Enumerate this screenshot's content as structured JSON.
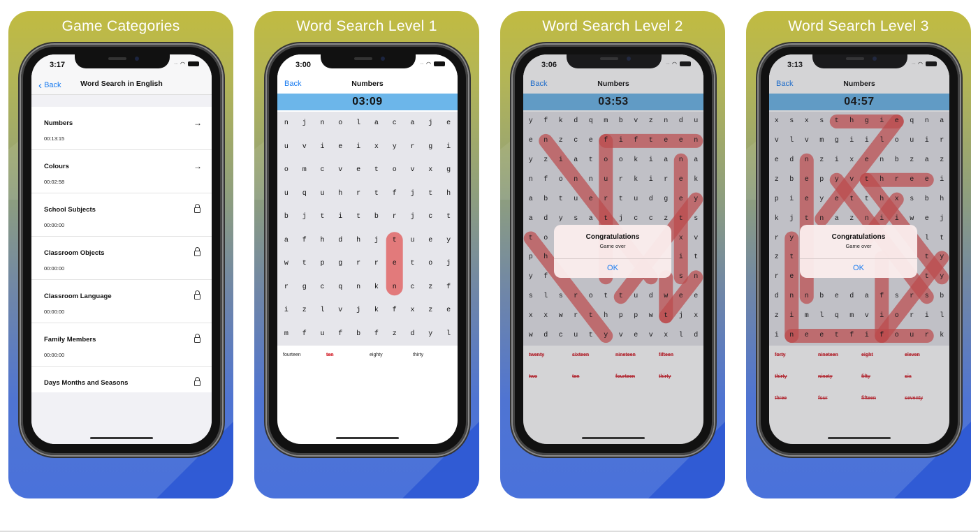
{
  "colors": {
    "accent": "#1a7cf0",
    "found": "#d3212b",
    "highlight": "#e0504f",
    "timer_band": "#6cb6ea"
  },
  "panels": [
    {
      "title": "Game Categories",
      "time": "3:17",
      "nav": {
        "back": "Back",
        "title": "Word Search in English"
      },
      "categories": [
        {
          "name": "Numbers",
          "time": "00:13:15",
          "icon": "arrow-right-icon"
        },
        {
          "name": "Colours",
          "time": "00:02:58",
          "icon": "arrow-right-icon"
        },
        {
          "name": "School Subjects",
          "time": "00:00:00",
          "icon": "lock-icon"
        },
        {
          "name": "Classroom Objects",
          "time": "00:00:00",
          "icon": "lock-icon"
        },
        {
          "name": "Classroom Language",
          "time": "00:00:00",
          "icon": "lock-icon"
        },
        {
          "name": "Family Members",
          "time": "00:00:00",
          "icon": "lock-icon"
        },
        {
          "name": "Days Months and Seasons",
          "time": "00:00:00",
          "icon": "lock-icon"
        }
      ]
    },
    {
      "title": "Word Search Level 1",
      "time": "3:00",
      "nav": {
        "back": "Back",
        "title": "Numbers"
      },
      "timer": "03:09",
      "grid": [
        "njnolacaje",
        "uvieixyrgi",
        "omcvetovxg",
        "uquhrtfjth",
        "bjtitbrjct",
        "afhdhjtuey",
        "wtpgrretoj",
        "rgcqnknczf",
        "izlvjkfxze",
        "mfufbfzdyl"
      ],
      "highlights": [
        [
          5,
          6,
          7,
          6
        ]
      ],
      "words": [
        {
          "text": "fourteen",
          "found": false
        },
        {
          "text": "ten",
          "found": true
        },
        {
          "text": "eighty",
          "found": false
        },
        {
          "text": "thirty",
          "found": false
        }
      ]
    },
    {
      "title": "Word Search Level 2",
      "time": "3:06",
      "nav": {
        "back": "Back",
        "title": "Numbers"
      },
      "timer": "03:53",
      "grid": [
        "yfkdqmbvzndu",
        "enzcefifteen",
        "yziatookiana",
        "nfonnurkirek",
        "abtuertudgey",
        "adysatjcczts",
        "to        xv",
        "ph        it",
        "yf        sn",
        "slsrottudwee",
        "xxwrthppwtjx",
        "wdcutyvevxld"
      ],
      "highlights": [
        [
          1,
          5,
          1,
          11
        ],
        [
          1,
          5,
          8,
          5
        ],
        [
          1,
          1,
          8,
          8
        ],
        [
          2,
          10,
          8,
          10
        ],
        [
          4,
          11,
          9,
          6
        ],
        [
          6,
          0,
          11,
          5
        ],
        [
          8,
          9,
          10,
          9
        ],
        [
          8,
          11,
          10,
          9
        ]
      ],
      "words": [
        {
          "text": "twenty",
          "found": true
        },
        {
          "text": "sixteen",
          "found": true
        },
        {
          "text": "nineteen",
          "found": true
        },
        {
          "text": "fifteen",
          "found": true
        },
        {
          "text": "two",
          "found": true
        },
        {
          "text": "ten",
          "found": true
        },
        {
          "text": "fourteen",
          "found": true
        },
        {
          "text": "thirty",
          "found": true
        }
      ],
      "dialog": {
        "title": "Congratulations",
        "message": "Game over",
        "ok": "OK"
      }
    },
    {
      "title": "Word Search Level 3",
      "time": "3:13",
      "nav": {
        "back": "Back",
        "title": "Numbers"
      },
      "timer": "04:57",
      "grid": [
        "xsxsthgieqna",
        "vlvmgiilouir",
        "ednzixenbzaz",
        "zbepyvthreei",
        "pieyetthxsbh",
        "kjtnazniiwej",
        "ry        lt",
        "zt        ty",
        "re        ty",
        "dnnbedafsrsb",
        "zimlqmvioril",
        "ineetfifourk"
      ],
      "highlights": [
        [
          0,
          4,
          0,
          8
        ],
        [
          0,
          8,
          5,
          3
        ],
        [
          2,
          2,
          9,
          2
        ],
        [
          3,
          6,
          3,
          10
        ],
        [
          3,
          4,
          9,
          10
        ],
        [
          3,
          6,
          8,
          11
        ],
        [
          4,
          8,
          6,
          6
        ],
        [
          6,
          1,
          11,
          1
        ],
        [
          11,
          1,
          11,
          10
        ],
        [
          7,
          7,
          11,
          7
        ],
        [
          7,
          11,
          11,
          7
        ]
      ],
      "words": [
        {
          "text": "forty",
          "found": true
        },
        {
          "text": "nineteen",
          "found": true
        },
        {
          "text": "eight",
          "found": true
        },
        {
          "text": "eleven",
          "found": true
        },
        {
          "text": "thirty",
          "found": true
        },
        {
          "text": "ninety",
          "found": true
        },
        {
          "text": "fifty",
          "found": true
        },
        {
          "text": "six",
          "found": true
        },
        {
          "text": "three",
          "found": true
        },
        {
          "text": "four",
          "found": true
        },
        {
          "text": "fifteen",
          "found": true
        },
        {
          "text": "seventy",
          "found": true
        }
      ],
      "dialog": {
        "title": "Congratulations",
        "message": "Game over",
        "ok": "OK"
      }
    }
  ]
}
